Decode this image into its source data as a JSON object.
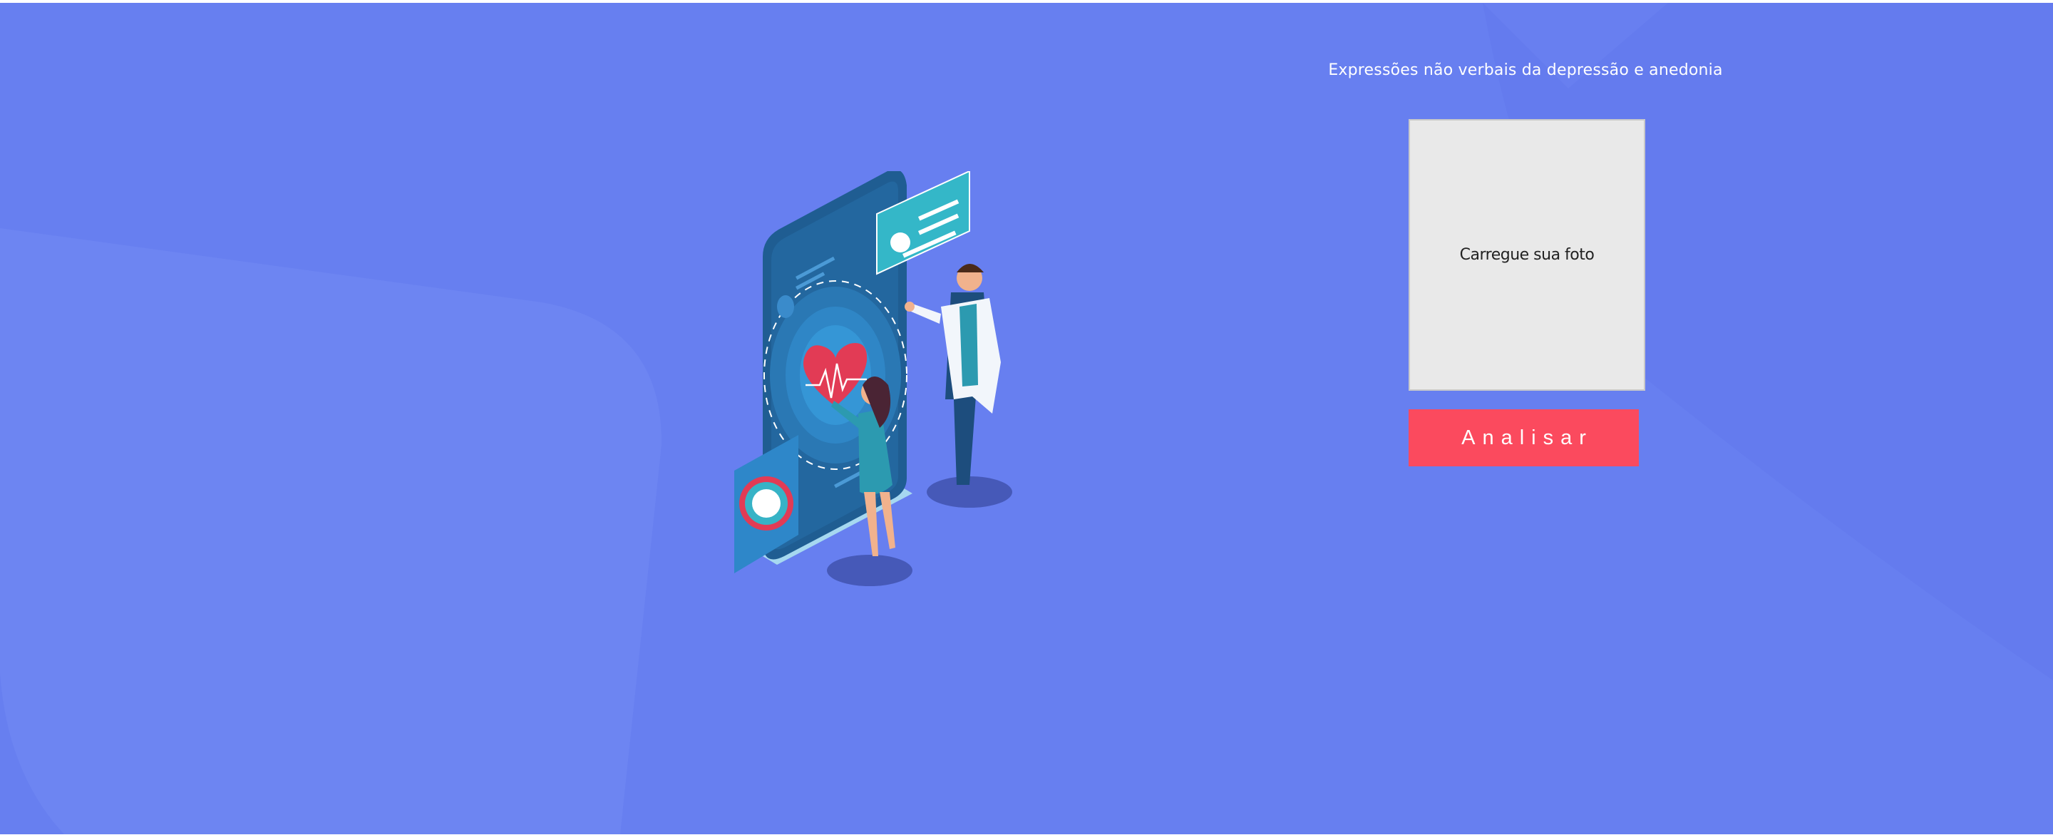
{
  "header": {
    "title": "Expressões não verbais da depressão e anedonia"
  },
  "upload": {
    "label": "Carregue sua foto"
  },
  "actions": {
    "analyze_label": "Analisar"
  },
  "colors": {
    "background": "#677ff0",
    "button": "#fb4a5e",
    "upload_box": "#e9e9e9"
  },
  "illustration": {
    "icon": "medical-app-doctor-patient-illustration"
  }
}
